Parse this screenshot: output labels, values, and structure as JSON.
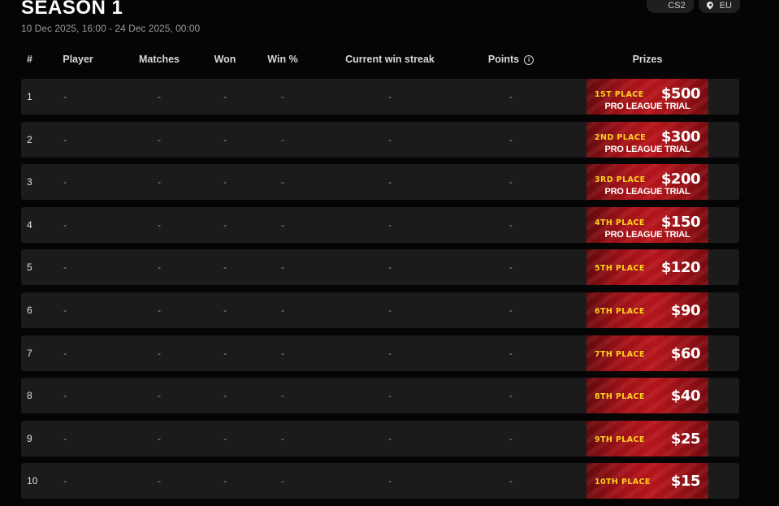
{
  "page": {
    "title": "SEASON 1",
    "date_range": "10 Dec 2025, 16:00 - 24 Dec 2025, 00:00",
    "tags": [
      {
        "label": "CS2",
        "icon": "game-icon"
      },
      {
        "label": "EU",
        "icon": "location-pin-icon"
      }
    ]
  },
  "table": {
    "headers": {
      "rank": "#",
      "player": "Player",
      "matches": "Matches",
      "won": "Won",
      "win_pct": "Win %",
      "streak": "Current win streak",
      "points": "Points",
      "prizes": "Prizes"
    },
    "rows": [
      {
        "rank": "1",
        "player": "-",
        "matches": "-",
        "won": "-",
        "win_pct": "-",
        "streak": "-",
        "points": "-",
        "place": "1ST PLACE",
        "amount": "$500",
        "extra": "PRO LEAGUE TRIAL"
      },
      {
        "rank": "2",
        "player": "-",
        "matches": "-",
        "won": "-",
        "win_pct": "-",
        "streak": "-",
        "points": "-",
        "place": "2ND PLACE",
        "amount": "$300",
        "extra": "PRO LEAGUE TRIAL"
      },
      {
        "rank": "3",
        "player": "-",
        "matches": "-",
        "won": "-",
        "win_pct": "-",
        "streak": "-",
        "points": "-",
        "place": "3RD PLACE",
        "amount": "$200",
        "extra": "PRO LEAGUE TRIAL"
      },
      {
        "rank": "4",
        "player": "-",
        "matches": "-",
        "won": "-",
        "win_pct": "-",
        "streak": "-",
        "points": "-",
        "place": "4TH PLACE",
        "amount": "$150",
        "extra": "PRO LEAGUE TRIAL"
      },
      {
        "rank": "5",
        "player": "-",
        "matches": "-",
        "won": "-",
        "win_pct": "-",
        "streak": "-",
        "points": "-",
        "place": "5TH PLACE",
        "amount": "$120",
        "extra": ""
      },
      {
        "rank": "6",
        "player": "-",
        "matches": "-",
        "won": "-",
        "win_pct": "-",
        "streak": "-",
        "points": "-",
        "place": "6TH PLACE",
        "amount": "$90",
        "extra": ""
      },
      {
        "rank": "7",
        "player": "-",
        "matches": "-",
        "won": "-",
        "win_pct": "-",
        "streak": "-",
        "points": "-",
        "place": "7TH PLACE",
        "amount": "$60",
        "extra": ""
      },
      {
        "rank": "8",
        "player": "-",
        "matches": "-",
        "won": "-",
        "win_pct": "-",
        "streak": "-",
        "points": "-",
        "place": "8TH PLACE",
        "amount": "$40",
        "extra": ""
      },
      {
        "rank": "9",
        "player": "-",
        "matches": "-",
        "won": "-",
        "win_pct": "-",
        "streak": "-",
        "points": "-",
        "place": "9TH PLACE",
        "amount": "$25",
        "extra": ""
      },
      {
        "rank": "10",
        "player": "-",
        "matches": "-",
        "won": "-",
        "win_pct": "-",
        "streak": "-",
        "points": "-",
        "place": "10TH PLACE",
        "amount": "$15",
        "extra": ""
      }
    ]
  },
  "colors": {
    "background": "#050505",
    "row": "#1b1b1b",
    "prize_red": "#b3161c",
    "place_yellow": "#ffd21f"
  }
}
